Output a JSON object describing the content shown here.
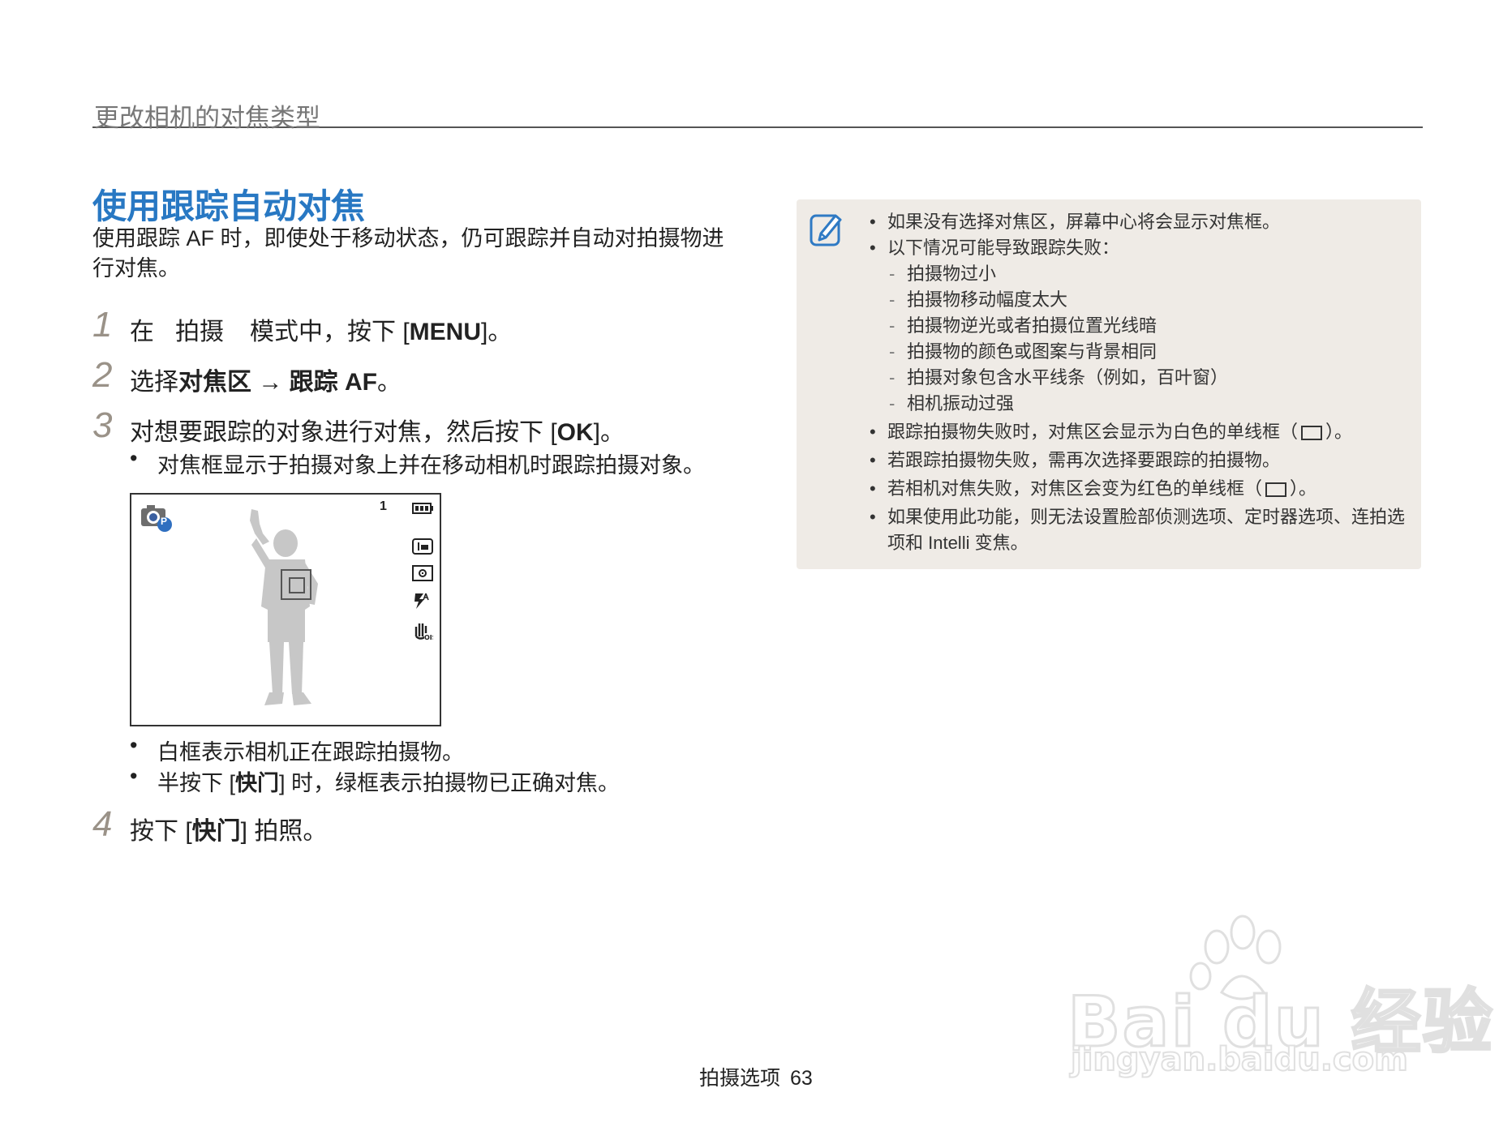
{
  "header": {
    "section_title": "更改相机的对焦类型"
  },
  "main": {
    "title": "使用跟踪自动对焦",
    "intro": "使用跟踪 AF 时，即使处于移动状态，仍可跟踪并自动对拍摄物进行对焦。",
    "steps": [
      {
        "num": "1",
        "part_a": "在",
        "part_b": "拍摄",
        "part_c": "模式中，按下 [",
        "key": "MENU",
        "part_d": "]。"
      },
      {
        "num": "2",
        "part_a": "选择",
        "bold_a": "对焦区",
        "arrow": " → ",
        "bold_b": "跟踪 AF",
        "part_end": "。"
      },
      {
        "num": "3",
        "part_a": "对想要跟踪的对象进行对焦，然后按下 [",
        "key": "OK",
        "part_d": "]。"
      },
      {
        "num": "4",
        "part_a": "按下 [",
        "key": "快门",
        "part_d": "] 拍照。"
      }
    ],
    "step3_bullet": "对焦框显示于拍摄对象上并在移动相机时跟踪拍摄对象。",
    "after_bullets": [
      "白框表示相机正在跟踪拍摄物。",
      {
        "a": "半按下 [",
        "key": "快门",
        "b": "] 时，绿框表示拍摄物已正确对焦。"
      }
    ],
    "bullet_glyph": "•"
  },
  "screen": {
    "shot_count": "1",
    "mode_badge": "P"
  },
  "notes": {
    "items": [
      "如果没有选择对焦区，屏幕中心将会显示对焦框。",
      "以下情况可能导致跟踪失败："
    ],
    "sub_items": [
      "拍摄物过小",
      "拍摄物移动幅度太大",
      "拍摄物逆光或者拍摄位置光线暗",
      "拍摄物的颜色或图案与背景相同",
      "拍摄对象包含水平线条（例如，百叶窗）",
      "相机振动过强"
    ],
    "item3_a": "跟踪拍摄物失败时，对焦区会显示为白色的单线框（",
    "item3_b": "）。",
    "item4": "若跟踪拍摄物失败，需再次选择要跟踪的拍摄物。",
    "item5_a": "若相机对焦失败，对焦区会变为红色的单线框（",
    "item5_b": "）。",
    "item6": "如果使用此功能，则无法设置脸部侦测选项、定时器选项、连拍选项和 Intelli 变焦。",
    "dash": "-"
  },
  "footer": {
    "section": "拍摄选项",
    "page": "63"
  },
  "watermark": {
    "brand": "Bai du 经验",
    "url": "jingyan.baidu.com"
  },
  "colors": {
    "title_blue": "#2878c3",
    "note_bg": "#efebe6",
    "step_num": "#9a9288"
  }
}
